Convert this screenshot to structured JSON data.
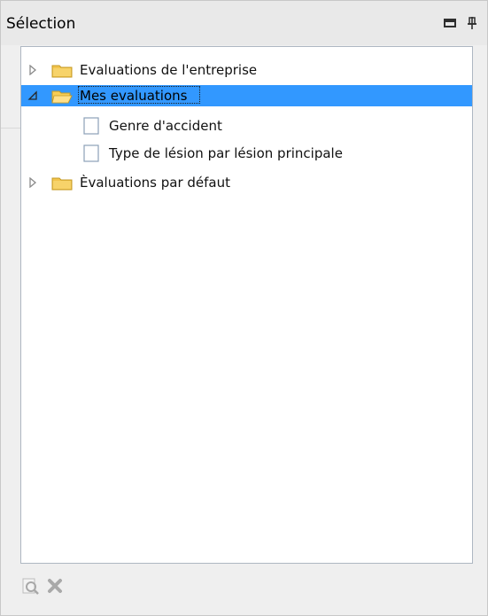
{
  "panel": {
    "title": "Sélection",
    "minimize_icon": "minimize-icon",
    "pin_icon": "pin-icon"
  },
  "tree": {
    "items": [
      {
        "label": "Evaluations de l'entreprise",
        "type": "folder",
        "expanded": false,
        "selected": false,
        "icon": "folder-icon"
      },
      {
        "label": "Mes evaluations",
        "type": "folder",
        "expanded": true,
        "selected": true,
        "icon": "open-folder-icon"
      },
      {
        "label": "Genre d'accident",
        "type": "document",
        "selected": false,
        "icon": "document-icon"
      },
      {
        "label": "Type de lésion par lésion principale",
        "type": "document",
        "selected": false,
        "icon": "document-icon"
      },
      {
        "label": "Èvaluations par défaut",
        "type": "folder",
        "expanded": false,
        "selected": false,
        "icon": "folder-icon"
      }
    ]
  },
  "toolbar": {
    "actions": [
      {
        "name": "search",
        "icon": "search-icon",
        "enabled": false
      },
      {
        "name": "delete",
        "icon": "delete-icon",
        "enabled": false
      }
    ]
  },
  "colors": {
    "selection": "#3298ff",
    "folder": "#f2c44d",
    "panel_bg": "#efefef",
    "border": "#aeb7c2"
  }
}
